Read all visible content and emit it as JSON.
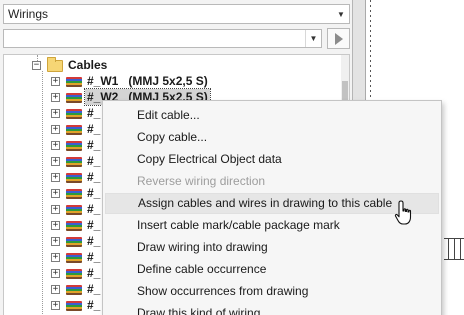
{
  "panel": {
    "combo_value": "Wirings",
    "filter_value": "",
    "filter_placeholder": ""
  },
  "tree": {
    "root_label": "Cables",
    "selected_cable": {
      "id": "#_W2",
      "desc": "(MMJ 5x2,5 S)"
    },
    "first_cable": {
      "id": "#_W1",
      "desc": "(MMJ 5x2,5 S)"
    },
    "partial_rows": [
      "#_",
      "#_",
      "#_",
      "#_",
      "#_",
      "#_",
      "#_",
      "#_",
      "#_",
      "#_",
      "#_",
      "#_",
      "#_"
    ]
  },
  "context_menu": {
    "items": [
      {
        "label": "Edit cable...",
        "disabled": false
      },
      {
        "label": "Copy cable...",
        "disabled": false
      },
      {
        "label": "Copy Electrical Object data",
        "disabled": false
      },
      {
        "label": "Reverse wiring direction",
        "disabled": true
      },
      {
        "label": "Assign cables and wires in drawing to this cable",
        "disabled": false,
        "hover": true
      },
      {
        "label": "Insert cable mark/cable package mark",
        "disabled": false
      },
      {
        "label": "Draw wiring into drawing",
        "disabled": false
      },
      {
        "label": "Define cable occurrence",
        "disabled": false
      },
      {
        "label": "Show occurrences from drawing",
        "disabled": false
      },
      {
        "label": "Draw this kind of wiring",
        "disabled": false
      }
    ]
  },
  "icons": {
    "combo_dropdown": "chevron-down-icon",
    "filter_dropdown": "chevron-down-icon",
    "go_button": "arrow-right-icon",
    "root_folder": "folder-open-icon",
    "cable": "cable-icon",
    "cursor": "hand-pointer-icon"
  }
}
